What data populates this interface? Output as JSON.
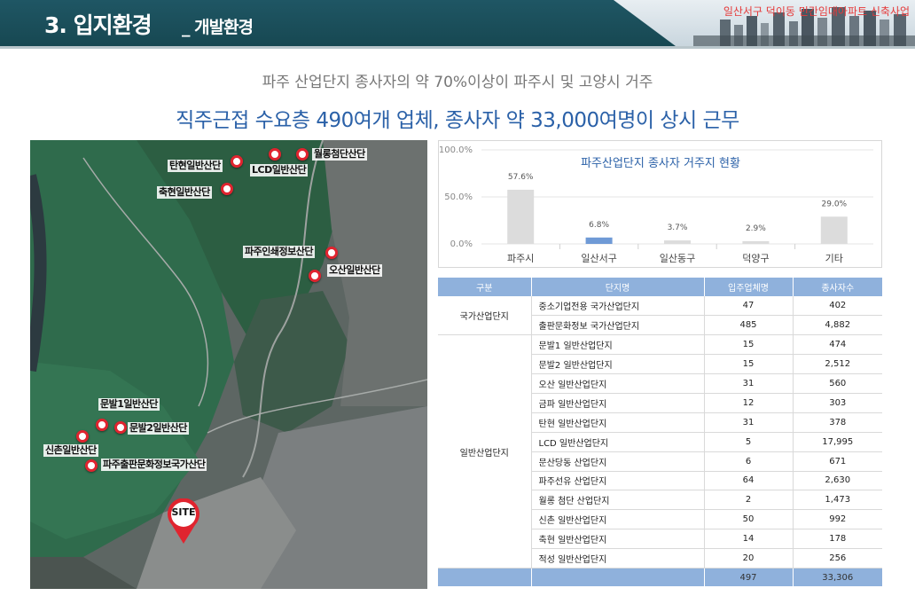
{
  "header": {
    "title": "3. 입지환경",
    "subtitle": "_ 개발환경",
    "project_tag": "일산서구 덕이동 민간임대아파트 신축사업"
  },
  "headline": {
    "line1": "파주 산업단지 종사자의 약 70%이상이 파주시 및 고양시 거주",
    "line2": "직주근접 수요층 490여개 업체, 종사자 약 33,000여명이 상시 근무"
  },
  "map": {
    "site_label": "SITE",
    "labels": {
      "wolleung": "월롱첨단산단",
      "lcd": "LCD일반산단",
      "tanhyeon": "탄현일반산단",
      "chukhyeon": "축현일반산단",
      "printing": "파주인쇄정보산단",
      "osan": "오산일반산단",
      "munbal1": "문발1일반산단",
      "munbal2": "문발2일반산단",
      "sinchon": "신촌일반산단",
      "publishing": "파주출판문화정보국가산단"
    }
  },
  "chart_data": {
    "type": "bar",
    "title": "파주산업단지 종사자 거주지 현황",
    "categories": [
      "파주시",
      "일산서구",
      "일산동구",
      "덕양구",
      "기타"
    ],
    "values": [
      57.6,
      6.8,
      3.7,
      2.9,
      29.0
    ],
    "value_labels": [
      "57.6%",
      "6.8%",
      "3.7%",
      "2.9%",
      "29.0%"
    ],
    "y_ticks": [
      "0.0%",
      "50.0%",
      "100.0%"
    ],
    "ylim": [
      0,
      100
    ],
    "colors": [
      "#dcdcdc",
      "#6f9ad6",
      "#dcdcdc",
      "#dcdcdc",
      "#dcdcdc"
    ],
    "grid": true
  },
  "table": {
    "columns": [
      "구분",
      "단지명",
      "입주업체명",
      "종사자수"
    ],
    "groups": [
      {
        "name": "국가산업단지",
        "rows": [
          [
            "중소기업전용 국가산업단지",
            "47",
            "402"
          ],
          [
            "출판문화정보 국가산업단지",
            "485",
            "4,882"
          ]
        ]
      },
      {
        "name": "일반산업단지",
        "rows": [
          [
            "문발1 일반산업단지",
            "15",
            "474"
          ],
          [
            "문발2 일반산업단지",
            "15",
            "2,512"
          ],
          [
            "오산 일반산업단지",
            "31",
            "560"
          ],
          [
            "금파 일반산업단지",
            "12",
            "303"
          ],
          [
            "탄현 일반산업단지",
            "31",
            "378"
          ],
          [
            "LCD 일반산업단지",
            "5",
            "17,995"
          ],
          [
            "문산당동 산업단지",
            "6",
            "671"
          ],
          [
            "파주선유 산업단지",
            "64",
            "2,630"
          ],
          [
            "월롱 첨단 산업단지",
            "2",
            "1,473"
          ],
          [
            "신촌 일반산업단지",
            "50",
            "992"
          ],
          [
            "축현 일반산업단지",
            "14",
            "178"
          ],
          [
            "적성 일반산업단지",
            "20",
            "256"
          ]
        ]
      }
    ],
    "total": [
      "",
      "",
      "497",
      "33,306"
    ]
  }
}
